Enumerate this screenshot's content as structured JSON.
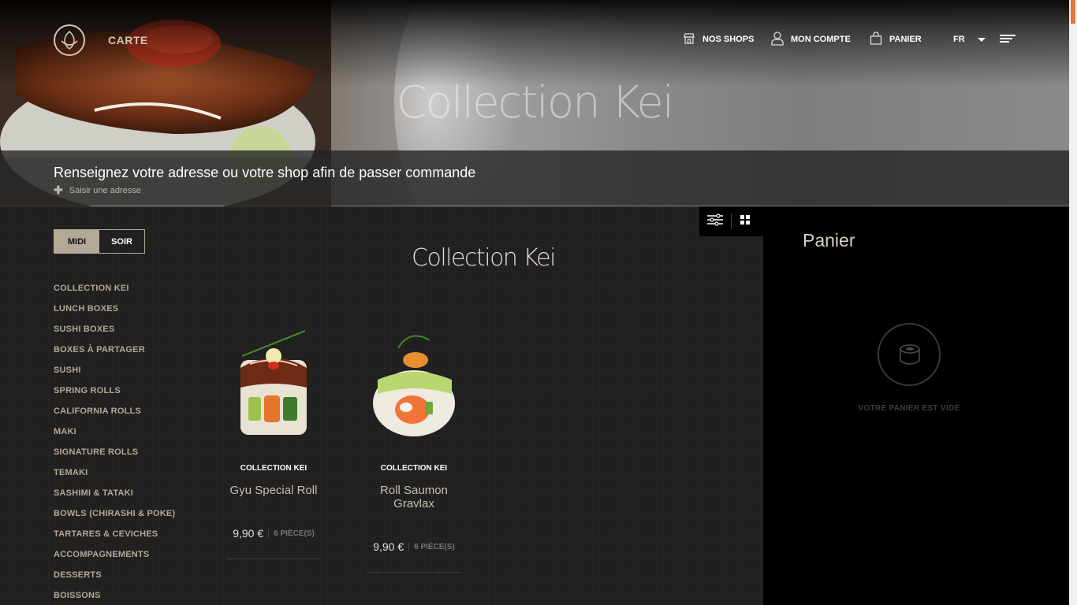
{
  "header": {
    "section_label": "CARTE",
    "nav": {
      "shops": "NOS SHOPS",
      "account": "MON COMPTE",
      "cart": "PANIER",
      "lang": "FR"
    },
    "hero_title": "Collection Kei",
    "address_prompt": "Renseignez votre adresse ou votre shop afin de passer commande",
    "address_link": "Saisir une adresse"
  },
  "menu_toggle": {
    "midi": "MIDI",
    "soir": "SOIR",
    "active": "MIDI"
  },
  "categories": [
    "COLLECTION KEI",
    "LUNCH BOXES",
    "SUSHI BOXES",
    "BOXES À PARTAGER",
    "SUSHI",
    "SPRING ROLLS",
    "CALIFORNIA ROLLS",
    "MAKI",
    "SIGNATURE ROLLS",
    "TEMAKI",
    "SASHIMI & TATAKI",
    "BOWLS (CHIRASHI & POKE)",
    "TARTARES & CEVICHES",
    "ACCOMPAGNEMENTS",
    "DESSERTS",
    "BOISSONS"
  ],
  "main": {
    "title": "Collection Kei",
    "products": [
      {
        "category": "COLLECTION KEI",
        "name": "Gyu Special Roll",
        "price": "9,90 €",
        "pieces": "6 PIÈCE(S)"
      },
      {
        "category": "COLLECTION KEI",
        "name": "Roll Saumon Gravlax",
        "price": "9,90 €",
        "pieces": "6 PIÈCE(S)"
      }
    ]
  },
  "cart": {
    "title": "Panier",
    "empty_text": "VOTRE PANIER EST VIDE"
  },
  "colors": {
    "accent": "#b5a897",
    "background": "#1e1e1e",
    "cart_bg": "#000000",
    "scroll_thumb": "#e0783a"
  },
  "icons": [
    "logo-icon",
    "store-icon",
    "user-icon",
    "bag-icon",
    "caret-down-icon",
    "menu-icon",
    "plus-icon",
    "filter-icon",
    "grid-icon",
    "sushi-empty-icon"
  ]
}
